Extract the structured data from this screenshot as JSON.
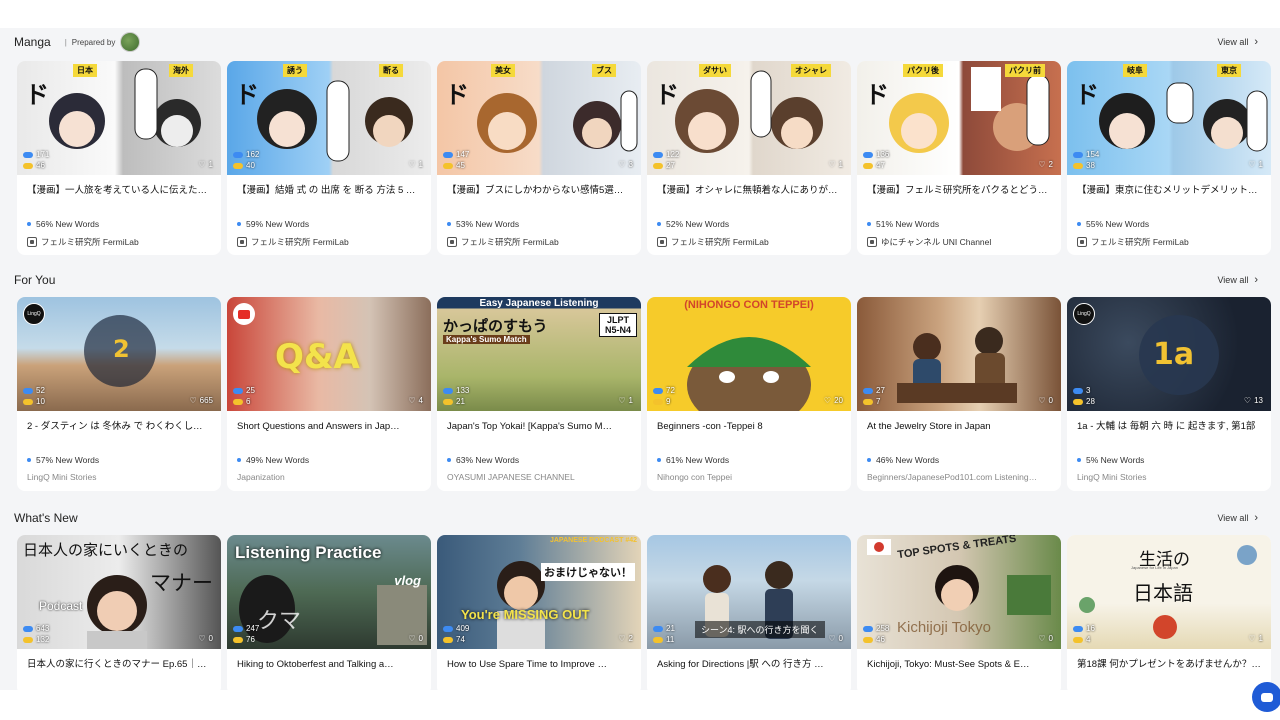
{
  "sections": [
    {
      "title": "Manga",
      "prepared_label": "Prepared by",
      "view_all": "View all",
      "cards": [
        {
          "title": "【漫画】一人旅を考えている人に伝えたいこ…",
          "new_words": "56% New Words",
          "source": "フェルミ研究所 FermiLab",
          "blue": "171",
          "yellow": "46",
          "likes": "1",
          "tags": [
            "日本",
            "海外"
          ]
        },
        {
          "title": "【漫画】結婚 式 の 出席 を 断る 方法 5 選…",
          "new_words": "59% New Words",
          "source": "フェルミ研究所 FermiLab",
          "blue": "162",
          "yellow": "40",
          "likes": "1",
          "tags": [
            "誘う",
            "断る"
          ]
        },
        {
          "title": "【漫画】ブスにしかわからない感情5選【マ…",
          "new_words": "53% New Words",
          "source": "フェルミ研究所 FermiLab",
          "blue": "147",
          "yellow": "45",
          "likes": "3",
          "tags": [
            "美女",
            "ブス"
          ]
        },
        {
          "title": "【漫画】オシャレに無頓着な人にありがちな…",
          "new_words": "52% New Words",
          "source": "フェルミ研究所 FermiLab",
          "blue": "122",
          "yellow": "27",
          "likes": "1",
          "tags": [
            "ダサい",
            "オシャレ"
          ]
        },
        {
          "title": "【漫画】フェルミ研究所をパクるとどうなる…",
          "new_words": "51% New Words",
          "source": "ゆにチャンネル UNI Channel",
          "blue": "136",
          "yellow": "47",
          "likes": "2",
          "tags": [
            "パクリ後",
            "パクリ前"
          ]
        },
        {
          "title": "【漫画】東京に住むメリットデメリット５選…",
          "new_words": "55% New Words",
          "source": "フェルミ研究所 FermiLab",
          "blue": "154",
          "yellow": "38",
          "likes": "1",
          "tags": [
            "岐阜",
            "東京"
          ]
        }
      ]
    },
    {
      "title": "For You",
      "view_all": "View all",
      "cards": [
        {
          "title": "2 - ダスティン は 冬休み で わくわくして…",
          "new_words": "57% New Words",
          "source": "LingQ Mini Stories",
          "blue": "52",
          "yellow": "10",
          "likes": "665",
          "overlay": "2"
        },
        {
          "title": "Short Questions and Answers in Jap…",
          "new_words": "49% New Words",
          "source": "Japanization",
          "blue": "25",
          "yellow": "6",
          "likes": "4",
          "overlay": "Q&A"
        },
        {
          "title": "Japan's Top Yokai! [Kappa's Sumo M…",
          "new_words": "63% New Words",
          "source": "OYASUMI JAPANESE CHANNEL",
          "blue": "133",
          "yellow": "21",
          "likes": "1",
          "banner": "Easy Japanese Listening",
          "overlay": "かっぱのすもう",
          "sub": "Kappa's Sumo Match",
          "jlpt": "JLPT N5-N4"
        },
        {
          "title": "Beginners -con -Teppei 8",
          "new_words": "61% New Words",
          "source": "Nihongo con Teppei",
          "blue": "72",
          "yellow": "9",
          "likes": "20",
          "overlay": "(NIHONGO CON TEPPEI)"
        },
        {
          "title": "At the Jewelry Store in Japan",
          "new_words": "46% New Words",
          "source": "Beginners/JapanesePod101.com Listening…",
          "blue": "27",
          "yellow": "7",
          "likes": "0"
        },
        {
          "title": "1a - 大輔 は 毎朝 六 時 に 起きます, 第1部",
          "new_words": "5% New Words",
          "source": "LingQ Mini Stories",
          "blue": "3",
          "yellow": "28",
          "likes": "13",
          "overlay": "1a"
        }
      ]
    },
    {
      "title": "What's New",
      "view_all": "View all",
      "cards": [
        {
          "title": "日本人の家に行くときのマナー Ep.65｜日…",
          "blue": "643",
          "yellow": "132",
          "likes": "0",
          "overlay": "日本人の家にいくときの",
          "overlay2": "マナー",
          "overlay3": "Podcast"
        },
        {
          "title": "Hiking to Oktoberfest and Talking a…",
          "blue": "247",
          "yellow": "76",
          "likes": "0",
          "overlay": "Listening Practice",
          "overlay2": "vlog",
          "overlay3": "クマ"
        },
        {
          "title": "How to Use Spare Time to Improve …",
          "blue": "409",
          "yellow": "74",
          "likes": "2",
          "overlay": "JAPANESE PODCAST #42",
          "overlay2": "おまけじゃない！",
          "overlay3": "You're MISSING OUT"
        },
        {
          "title": "Asking for Directions |駅 への 行き方 …",
          "blue": "21",
          "yellow": "11",
          "likes": "0",
          "overlay": "シーン4: 駅への行き方を聞く"
        },
        {
          "title": "Kichijoji, Tokyo: Must-See Spots & E…",
          "blue": "258",
          "yellow": "46",
          "likes": "0",
          "overlay": "TOP SPOTS & TREATS",
          "overlay2": "Kichijoji Tokyo"
        },
        {
          "title": "第18課 何かプレゼントをあげませんか？ (…",
          "blue": "16",
          "yellow": "4",
          "likes": "1",
          "overlay": "生活の",
          "overlay2": "日本語",
          "overlay3": "Japanese for Life in Japan"
        }
      ]
    }
  ],
  "colors": {
    "accent_blue": "#3d8bf2",
    "accent_yellow": "#f4c22b",
    "chat_button": "#1f5bd6"
  },
  "icons": [
    "chevron-right-icon",
    "heart-icon",
    "course-icon",
    "chat-icon"
  ]
}
